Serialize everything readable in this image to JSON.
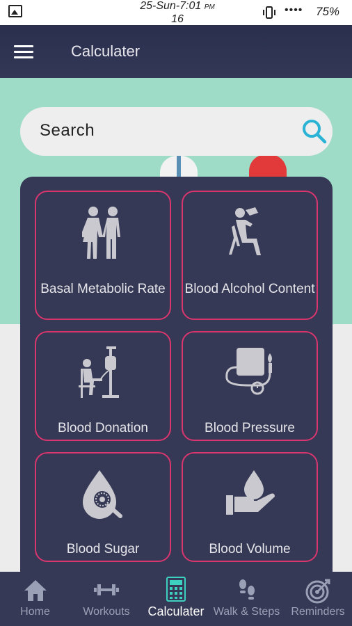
{
  "status_bar": {
    "time_line1": "25-Sun-7:01",
    "time_suffix": "PM",
    "time_line2": "16",
    "signal_dots": "••••",
    "battery": "75%"
  },
  "app_bar": {
    "menu_icon": "hamburger-icon",
    "title": "Calculater"
  },
  "search": {
    "placeholder": "Search",
    "icon": "search-icon",
    "accent": "#2bb3d6"
  },
  "tiles": [
    {
      "label": "Basal Metabolic Rate",
      "icon": "couple-icon"
    },
    {
      "label": "Blood Alcohol Content",
      "icon": "drinking-person-icon"
    },
    {
      "label": "Blood Donation",
      "icon": "blood-donation-icon"
    },
    {
      "label": "Blood Pressure",
      "icon": "blood-pressure-icon"
    },
    {
      "label": "Blood Sugar",
      "icon": "blood-drop-magnifier-icon"
    },
    {
      "label": "Blood Volume",
      "icon": "hand-drop-icon"
    }
  ],
  "bottom_nav": [
    {
      "label": "Home",
      "icon": "home-icon",
      "active": false
    },
    {
      "label": "Workouts",
      "icon": "dumbbell-icon",
      "active": false
    },
    {
      "label": "Calculater",
      "icon": "calculator-icon",
      "active": true
    },
    {
      "label": "Walk & Steps",
      "icon": "footsteps-icon",
      "active": false
    },
    {
      "label": "Reminders",
      "icon": "target-icon",
      "active": false
    }
  ],
  "colors": {
    "app_bar": "#2b2f4e",
    "hero": "#9fdcc8",
    "panel": "#353955",
    "tile_border": "#d9356e",
    "active_nav_icon": "#3ed1c2"
  }
}
